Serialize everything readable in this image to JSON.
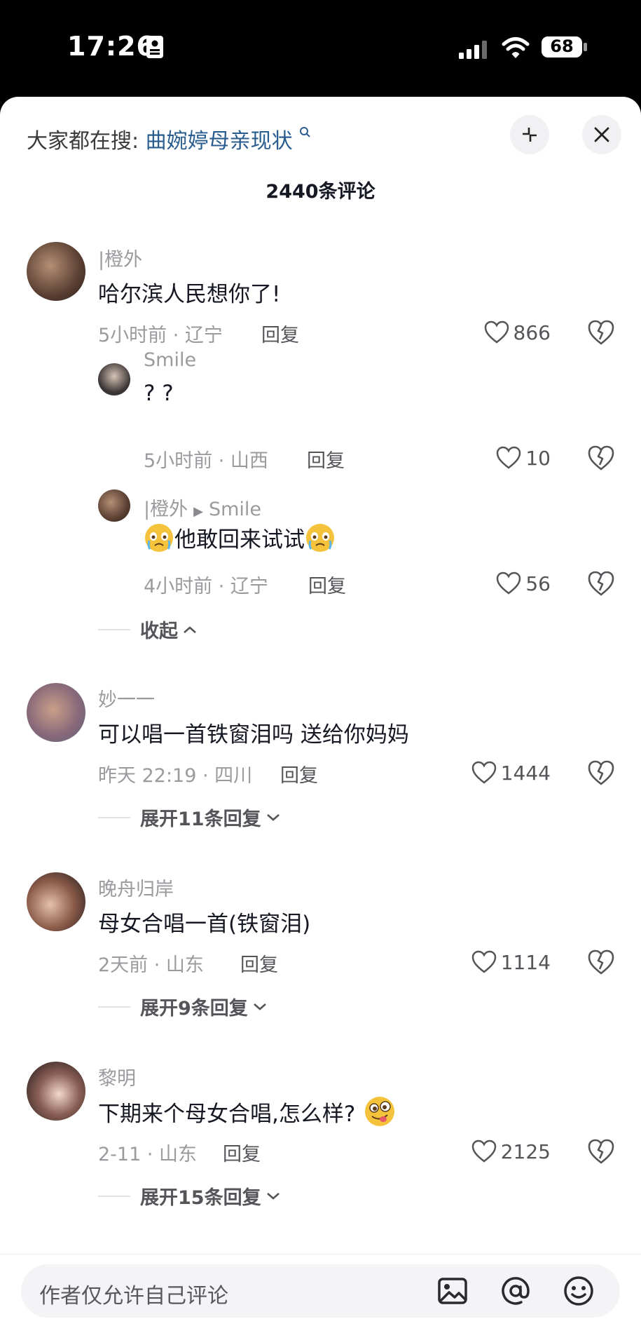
{
  "status_bar": {
    "time": "17:26",
    "battery": "68"
  },
  "header": {
    "search_prefix": "大家都在搜:",
    "search_query": "曲婉婷母亲现状",
    "comment_count": "2440条评论"
  },
  "comments": [
    {
      "user": "|橙外",
      "text": "哈尔滨人民想你了!",
      "time_loc": "5小时前 · 辽宁",
      "reply": "回复",
      "likes": "866"
    },
    {
      "user": "妙一一",
      "text": "可以唱一首铁窗泪吗 送给你妈妈",
      "time_loc": "昨天 22:19 · 四川",
      "reply": "回复",
      "likes": "1444",
      "expand": "展开11条回复"
    },
    {
      "user": "晚舟归岸",
      "text": "母女合唱一首(铁窗泪)",
      "time_loc": "2天前 · 山东",
      "reply": "回复",
      "likes": "1114",
      "expand": "展开9条回复"
    },
    {
      "user": "黎明",
      "text": "下期来个母女合唱,怎么样?",
      "time_loc": "2-11 · 山东",
      "reply": "回复",
      "likes": "2125",
      "expand": "展开15条回复"
    }
  ],
  "replies": [
    {
      "user": "Smile",
      "text": "? ?",
      "time_loc": "5小时前 · 山西",
      "reply": "回复",
      "likes": "10"
    },
    {
      "user": "|橙外",
      "reply_to": "Smile",
      "text": "他敢回来试试",
      "time_loc": "4小时前 · 辽宁",
      "reply": "回复",
      "likes": "56"
    }
  ],
  "collapse_label": "收起",
  "input": {
    "placeholder": "作者仅允许自己评论"
  },
  "colors": {
    "link": "#2a5d8f",
    "text": "#161823",
    "muted": "#9b9b9f"
  }
}
